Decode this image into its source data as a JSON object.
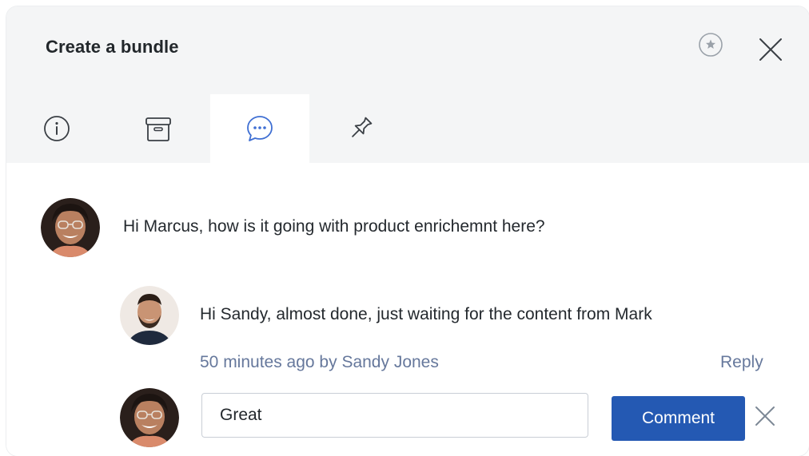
{
  "dialog": {
    "title": "Create a bundle"
  },
  "header_icons": [
    "star-icon",
    "close-icon"
  ],
  "tabs": [
    {
      "icon": "info-icon",
      "active": false
    },
    {
      "icon": "box-icon",
      "active": false
    },
    {
      "icon": "chat-bubble-icon",
      "active": true
    },
    {
      "icon": "pin-icon",
      "active": false
    }
  ],
  "comments": [
    {
      "author_avatar": "avatar-woman",
      "text": "Hi Marcus, how is it going with product enrichemnt here?"
    },
    {
      "author_avatar": "avatar-man",
      "text": "Hi Sandy, almost done, just waiting for the content from Mark",
      "meta": "50 minutes ago by Sandy Jones",
      "reply_label": "Reply"
    }
  ],
  "composer": {
    "avatar": "avatar-woman",
    "value": "Great",
    "submit_label": "Comment"
  },
  "colors": {
    "accent": "#2459b3",
    "active_tab_icon": "#3f6fd3",
    "meta_text": "#66789c",
    "header_bg": "#f4f5f6"
  }
}
